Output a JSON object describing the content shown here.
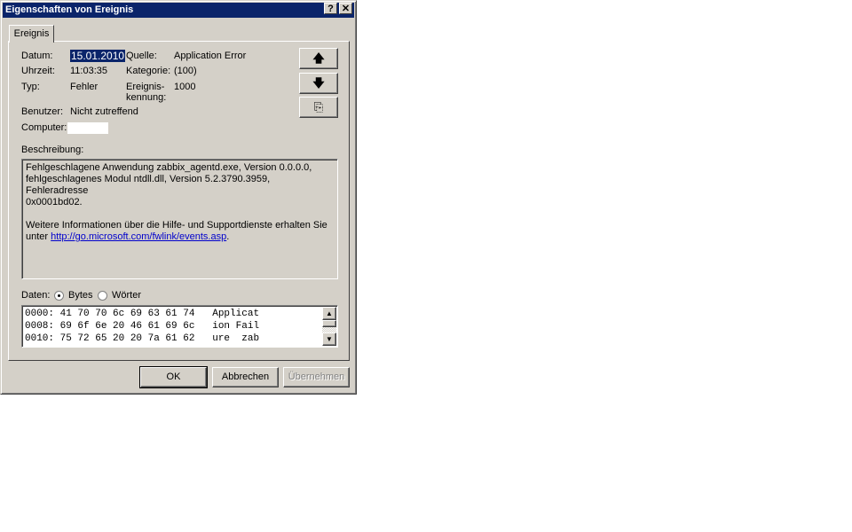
{
  "window": {
    "title": "Eigenschaften von Ereignis",
    "help": "?",
    "close": "✕"
  },
  "tab": "Ereignis",
  "fields": {
    "datum_label": "Datum:",
    "datum": "15.01.2010",
    "uhrzeit_label": "Uhrzeit:",
    "uhrzeit": "11:03:35",
    "typ_label": "Typ:",
    "typ": "Fehler",
    "benutzer_label": "Benutzer:",
    "benutzer": "Nicht zutreffend",
    "computer_label": "Computer:",
    "computer": "",
    "quelle_label": "Quelle:",
    "quelle": "Application Error",
    "kategorie_label": "Kategorie:",
    "kategorie": "(100)",
    "kennung_label1": "Ereignis-",
    "kennung_label2": "kennung:",
    "kennung": "1000"
  },
  "nav": {
    "up": "🡅",
    "down": "🡇",
    "copy": "⎘"
  },
  "description": {
    "label": "Beschreibung:",
    "line1": "Fehlgeschlagene Anwendung zabbix_agentd.exe, Version 0.0.0.0,",
    "line2": "fehlgeschlagenes Modul ntdll.dll, Version 5.2.3790.3959, Fehleradresse",
    "line3": "0x0001bd02.",
    "line4": "Weitere Informationen über die Hilfe- und Supportdienste erhalten Sie",
    "line5_prefix": "unter ",
    "link": "http://go.microsoft.com/fwlink/events.asp",
    "line5_suffix": "."
  },
  "data": {
    "label": "Daten:",
    "option_bytes": "Bytes",
    "option_words": "Wörter",
    "selected": "Bytes",
    "rows": [
      "0000: 41 70 70 6c 69 63 61 74   Applicat",
      "0008: 69 6f 6e 20 46 61 69 6c   ion Fail",
      "0010: 75 72 65 20 20 7a 61 62   ure  zab"
    ]
  },
  "buttons": {
    "ok": "OK",
    "cancel": "Abbrechen",
    "apply": "Übernehmen"
  }
}
